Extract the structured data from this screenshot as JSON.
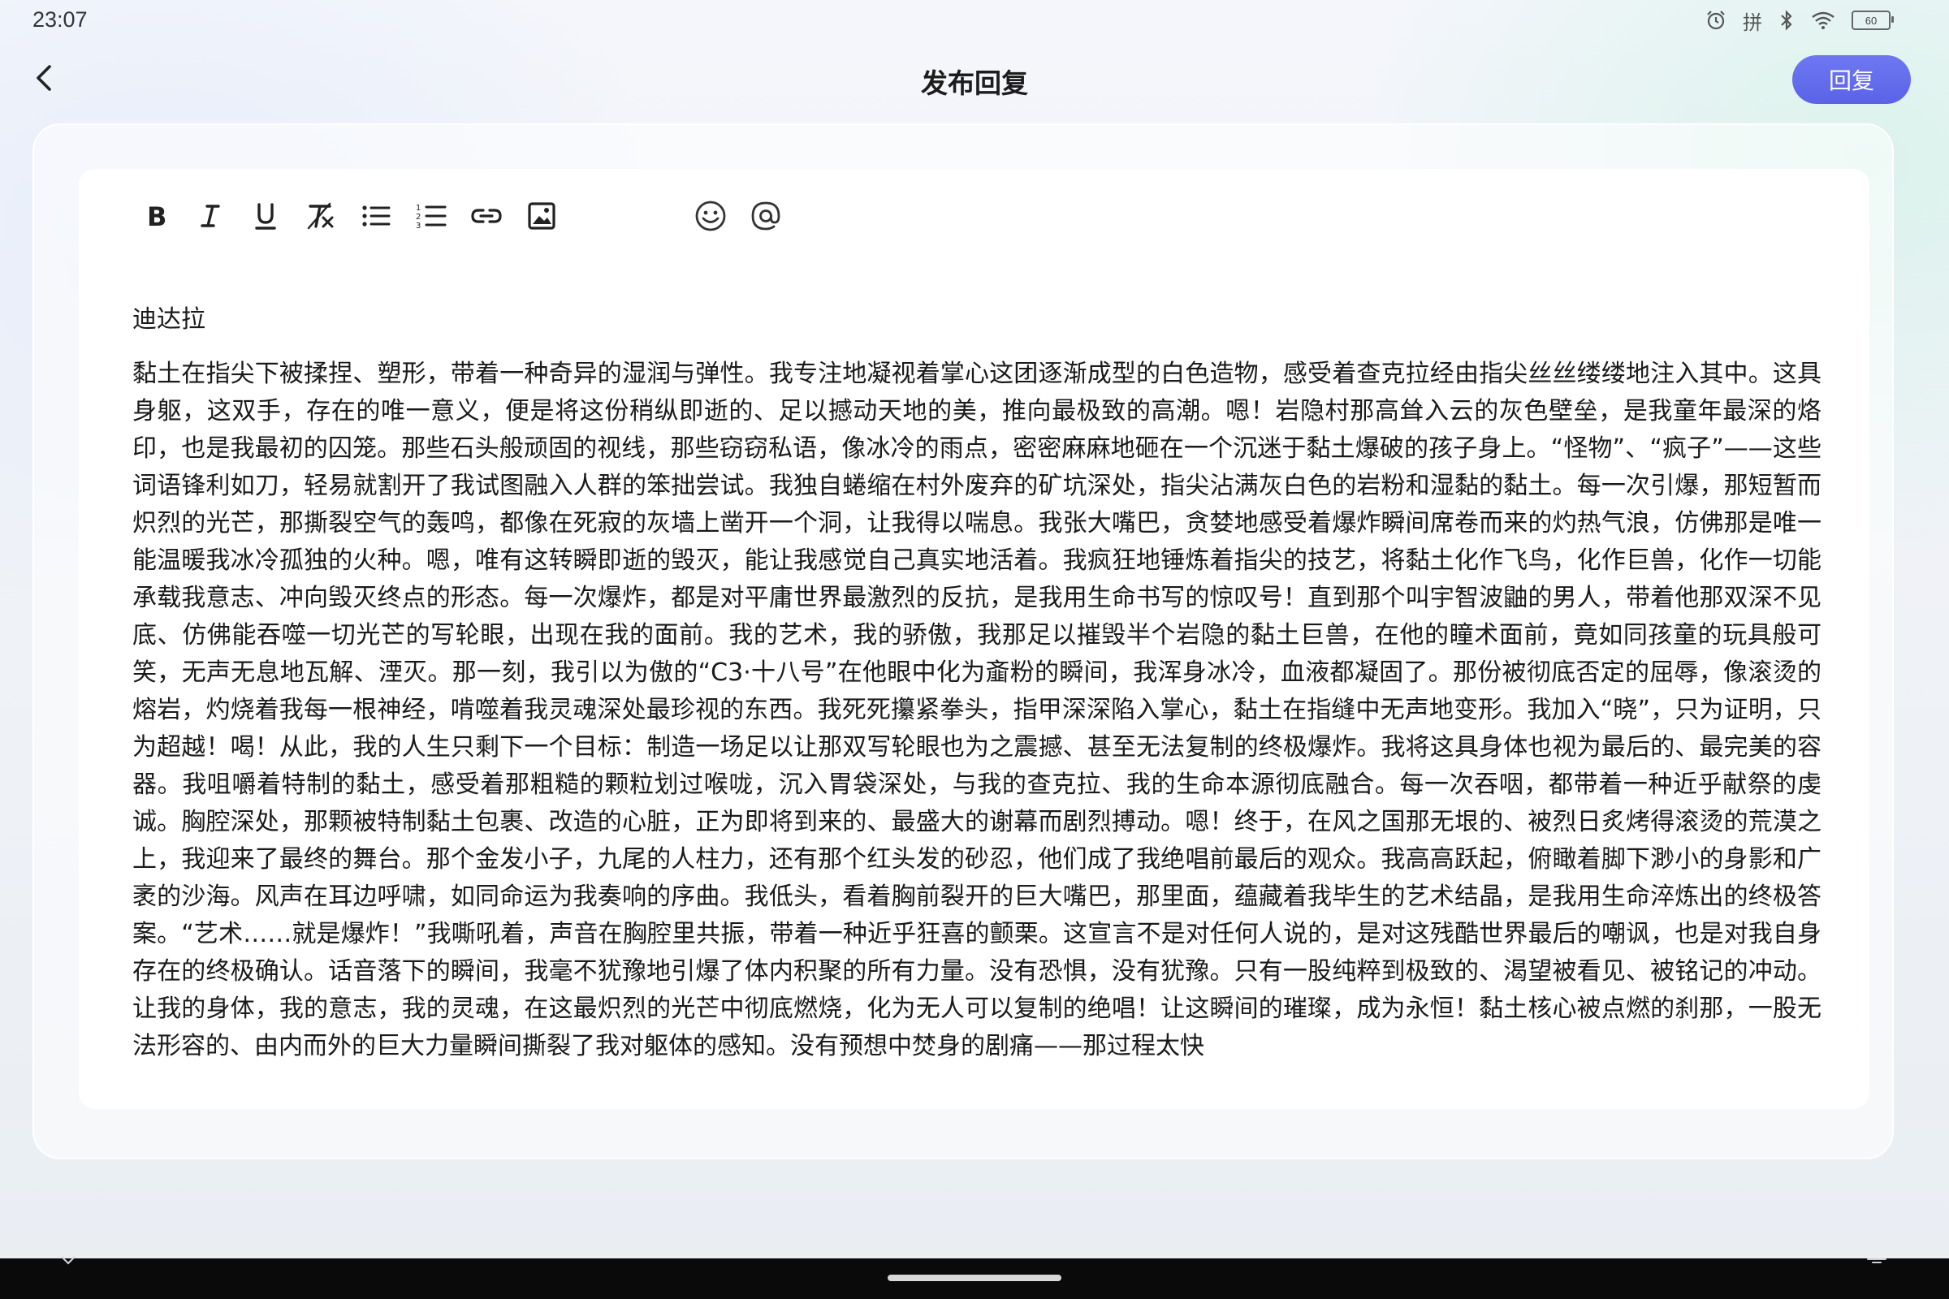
{
  "status_bar": {
    "time": "23:07",
    "ime_label": "拼",
    "battery_level": "60",
    "icons": [
      "alarm-icon",
      "ime-icon",
      "bluetooth-icon",
      "wifi-icon",
      "battery-icon"
    ]
  },
  "header": {
    "title": "发布回复",
    "reply_label": "回复",
    "back_icon": "chevron-left-icon",
    "accent_color": "#5f68eb"
  },
  "toolbar": {
    "items": [
      "bold-icon",
      "italic-icon",
      "underline-icon",
      "clear-format-icon",
      "bullet-list-icon",
      "numbered-list-icon",
      "link-icon",
      "image-icon",
      "emoji-icon",
      "mention-icon"
    ]
  },
  "editor": {
    "author": "迪达拉",
    "content": "黏土在指尖下被揉捏、塑形，带着一种奇异的湿润与弹性。我专注地凝视着掌心这团逐渐成型的白色造物，感受着查克拉经由指尖丝丝缕缕地注入其中。这具身躯，这双手，存在的唯一意义，便是将这份稍纵即逝的、足以撼动天地的美，推向最极致的高潮。嗯！岩隐村那高耸入云的灰色壁垒，是我童年最深的烙印，也是我最初的囚笼。那些石头般顽固的视线，那些窃窃私语，像冰冷的雨点，密密麻麻地砸在一个沉迷于黏土爆破的孩子身上。“怪物”、“疯子”——这些词语锋利如刀，轻易就割开了我试图融入人群的笨拙尝试。我独自蜷缩在村外废弃的矿坑深处，指尖沾满灰白色的岩粉和湿黏的黏土。每一次引爆，那短暂而炽烈的光芒，那撕裂空气的轰鸣，都像在死寂的灰墙上凿开一个洞，让我得以喘息。我张大嘴巴，贪婪地感受着爆炸瞬间席卷而来的灼热气浪，仿佛那是唯一能温暖我冰冷孤独的火种。嗯，唯有这转瞬即逝的毁灭，能让我感觉自己真实地活着。我疯狂地锤炼着指尖的技艺，将黏土化作飞鸟，化作巨兽，化作一切能承载我意志、冲向毁灭终点的形态。每一次爆炸，都是对平庸世界最激烈的反抗，是我用生命书写的惊叹号！直到那个叫宇智波鼬的男人，带着他那双深不见底、仿佛能吞噬一切光芒的写轮眼，出现在我的面前。我的艺术，我的骄傲，我那足以摧毁半个岩隐的黏土巨兽，在他的瞳术面前，竟如同孩童的玩具般可笑，无声无息地瓦解、湮灭。那一刻，我引以为傲的“C3·十八号”在他眼中化为齑粉的瞬间，我浑身冰冷，血液都凝固了。那份被彻底否定的屈辱，像滚烫的熔岩，灼烧着我每一根神经，啃噬着我灵魂深处最珍视的东西。我死死攥紧拳头，指甲深深陷入掌心，黏土在指缝中无声地变形。我加入“晓”，只为证明，只为超越！喝！从此，我的人生只剩下一个目标：制造一场足以让那双写轮眼也为之震撼、甚至无法复制的终极爆炸。我将这具身体也视为最后的、最完美的容器。我咀嚼着特制的黏土，感受着那粗糙的颗粒划过喉咙，沉入胃袋深处，与我的查克拉、我的生命本源彻底融合。每一次吞咽，都带着一种近乎献祭的虔诚。胸腔深处，那颗被特制黏土包裹、改造的心脏，正为即将到来的、最盛大的谢幕而剧烈搏动。嗯！终于，在风之国那无垠的、被烈日炙烤得滚烫的荒漠之上，我迎来了最终的舞台。那个金发小子，九尾的人柱力，还有那个红头发的砂忍，他们成了我绝唱前最后的观众。我高高跃起，俯瞰着脚下渺小的身影和广袤的沙海。风声在耳边呼啸，如同命运为我奏响的序曲。我低头，看着胸前裂开的巨大嘴巴，那里面，蕴藏着我毕生的艺术结晶，是我用生命淬炼出的终极答案。“艺术……就是爆炸！”我嘶吼着，声音在胸腔里共振，带着一种近乎狂喜的颤栗。这宣言不是对任何人说的，是对这残酷世界最后的嘲讽，也是对我自身存在的终极确认。话音落下的瞬间，我毫不犹豫地引爆了体内积聚的所有力量。没有恐惧，没有犹豫。只有一股纯粹到极致的、渴望被看见、被铭记的冲动。让我的身体，我的意志，我的灵魂，在这最炽烈的光芒中彻底燃烧，化为无人可以复制的绝唱！让这瞬间的璀璨，成为永恒！黏土核心被点燃的刹那，一股无法形容的、由内而外的巨大力量瞬间撕裂了我对躯体的感知。没有预想中焚身的剧痛——那过程太快"
  },
  "nav_bar": {
    "icons": [
      "chevron-down-icon",
      "home-indicator",
      "menu-icon"
    ]
  }
}
